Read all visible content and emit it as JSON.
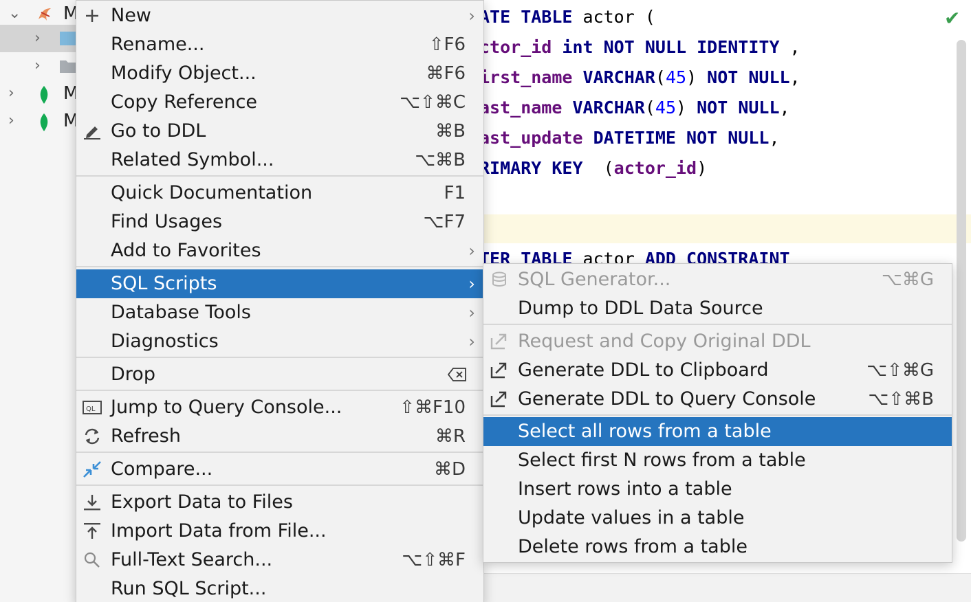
{
  "tree": {
    "rows": [
      {
        "label": "M",
        "expanded": true
      },
      {
        "label": "",
        "expanded": false
      },
      {
        "label": "",
        "expanded": false
      },
      {
        "label": "M",
        "expanded": false
      },
      {
        "label": "M",
        "expanded": false
      }
    ]
  },
  "editor": {
    "status": "✔"
  },
  "main_menu": {
    "items": {
      "new": {
        "label": "New",
        "shortcut": ""
      },
      "rename": {
        "label": "Rename...",
        "shortcut": "⇧F6"
      },
      "modify": {
        "label": "Modify Object...",
        "shortcut": "⌘F6"
      },
      "copy_ref": {
        "label": "Copy Reference",
        "shortcut": "⌥⇧⌘C"
      },
      "go_ddl": {
        "label": "Go to DDL",
        "shortcut": "⌘B"
      },
      "related": {
        "label": "Related Symbol...",
        "shortcut": "⌥⌘B"
      },
      "quick_doc": {
        "label": "Quick Documentation",
        "shortcut": "F1"
      },
      "find_usages": {
        "label": "Find Usages",
        "shortcut": "⌥F7"
      },
      "favorites": {
        "label": "Add to Favorites",
        "shortcut": ""
      },
      "sql_scripts": {
        "label": "SQL Scripts",
        "shortcut": ""
      },
      "db_tools": {
        "label": "Database Tools",
        "shortcut": ""
      },
      "diagnostics": {
        "label": "Diagnostics",
        "shortcut": ""
      },
      "drop": {
        "label": "Drop",
        "shortcut": ""
      },
      "jump_console": {
        "label": "Jump to Query Console...",
        "shortcut": "⇧⌘F10"
      },
      "refresh": {
        "label": "Refresh",
        "shortcut": "⌘R"
      },
      "compare": {
        "label": "Compare...",
        "shortcut": "⌘D"
      },
      "export": {
        "label": "Export Data to Files",
        "shortcut": ""
      },
      "import": {
        "label": "Import Data from File...",
        "shortcut": ""
      },
      "fulltext": {
        "label": "Full-Text Search...",
        "shortcut": "⌥⇧⌘F"
      },
      "run_script": {
        "label": "Run SQL Script...",
        "shortcut": ""
      }
    }
  },
  "sub_menu": {
    "items": {
      "sql_gen": {
        "label": "SQL Generator...",
        "shortcut": "⌥⌘G"
      },
      "dump_ddl": {
        "label": "Dump to DDL Data Source",
        "shortcut": ""
      },
      "request_copy": {
        "label": "Request and Copy Original DDL",
        "shortcut": ""
      },
      "gen_clip": {
        "label": "Generate DDL to Clipboard",
        "shortcut": "⌥⇧⌘G"
      },
      "gen_console": {
        "label": "Generate DDL to Query Console",
        "shortcut": "⌥⇧⌘B"
      },
      "select_all": {
        "label": "Select all rows from a table",
        "shortcut": ""
      },
      "select_n": {
        "label": "Select first N rows from a table",
        "shortcut": ""
      },
      "insert": {
        "label": "Insert rows into a table",
        "shortcut": ""
      },
      "update": {
        "label": "Update values in a table",
        "shortcut": ""
      },
      "delete": {
        "label": "Delete rows from a table",
        "shortcut": ""
      }
    }
  },
  "colors": {
    "selection": "#2675bf",
    "menu_bg": "#f2f2f2",
    "keyword": "#000080",
    "column": "#660e7a",
    "number": "#0000ff"
  }
}
